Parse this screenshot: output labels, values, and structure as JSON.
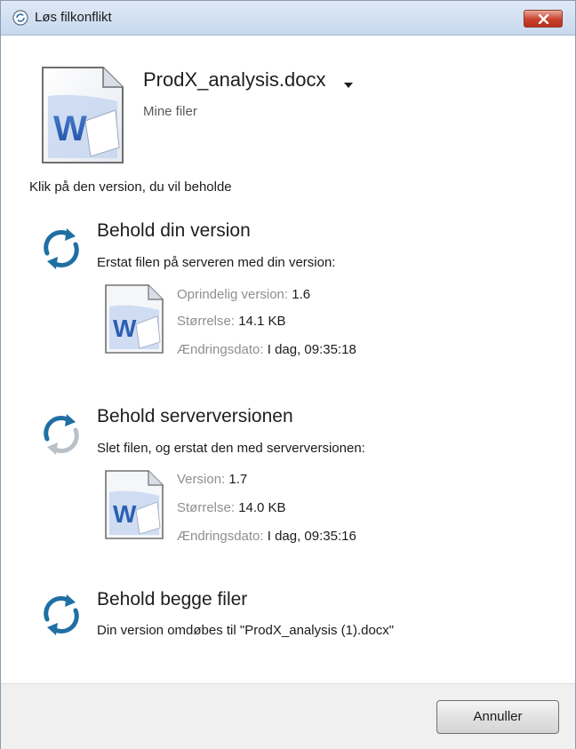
{
  "window": {
    "title": "Løs filkonflikt"
  },
  "file": {
    "name": "ProdX_analysis.docx",
    "location": "Mine filer",
    "icon": "word-document-icon"
  },
  "instruction": "Klik på den version, du vil beholde",
  "options": [
    {
      "title": "Behold din version",
      "description": "Erstat filen på serveren med din version:",
      "icon": "sync-icon",
      "details": [
        {
          "label": "Oprindelig version:",
          "value": "1.6"
        },
        {
          "label": "Størrelse:",
          "value": "14.1 KB"
        },
        {
          "label": "Ændringsdato:",
          "value": "I dag, 09:35:18"
        }
      ]
    },
    {
      "title": "Behold serverversionen",
      "description": "Slet filen, og erstat den med serverversionen:",
      "icon": "sync-icon",
      "details": [
        {
          "label": "Version:",
          "value": "1.7"
        },
        {
          "label": "Størrelse:",
          "value": "14.0 KB"
        },
        {
          "label": "Ændringsdato:",
          "value": "I dag, 09:35:16"
        }
      ]
    },
    {
      "title": "Behold begge filer",
      "description": "Din version omdøbes til \"ProdX_analysis (1).docx\"",
      "icon": "sync-icon"
    }
  ],
  "footer": {
    "cancel_label": "Annuller"
  },
  "colors": {
    "sync_blue": "#1f6fa3",
    "sync_gray": "#b9c0c7",
    "word_blue": "#2b5fb3",
    "close_red": "#c9412c"
  }
}
